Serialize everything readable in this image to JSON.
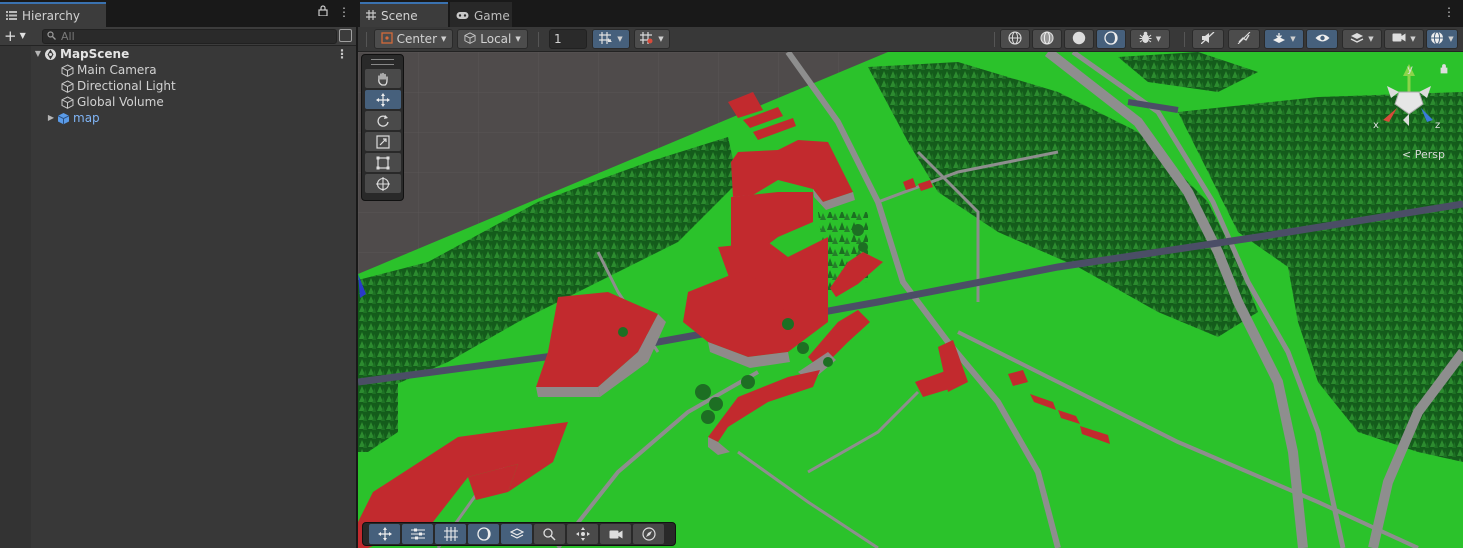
{
  "hierarchy": {
    "tab_label": "Hierarchy",
    "add_label": "+",
    "search_placeholder": "All",
    "scene_name": "MapScene",
    "items": [
      {
        "label": "Main Camera"
      },
      {
        "label": "Directional Light"
      },
      {
        "label": "Global Volume"
      },
      {
        "label": "map"
      }
    ]
  },
  "scene": {
    "tabs": [
      {
        "label": "Scene"
      },
      {
        "label": "Game"
      }
    ],
    "toolbar": {
      "pivot_mode": "Center",
      "pivot_rotation": "Local",
      "grid_snap_value": "1"
    },
    "view_label": "< Persp",
    "gizmo_axes": {
      "x": "x",
      "y": "y",
      "z": "z"
    }
  },
  "colors": {
    "accent": "#3a72b0",
    "active_button": "#46607c",
    "ground": "#2bc22b",
    "forest": "#1f7a26",
    "buildings": "#c22a2e",
    "roads": "#8e8e8e"
  }
}
